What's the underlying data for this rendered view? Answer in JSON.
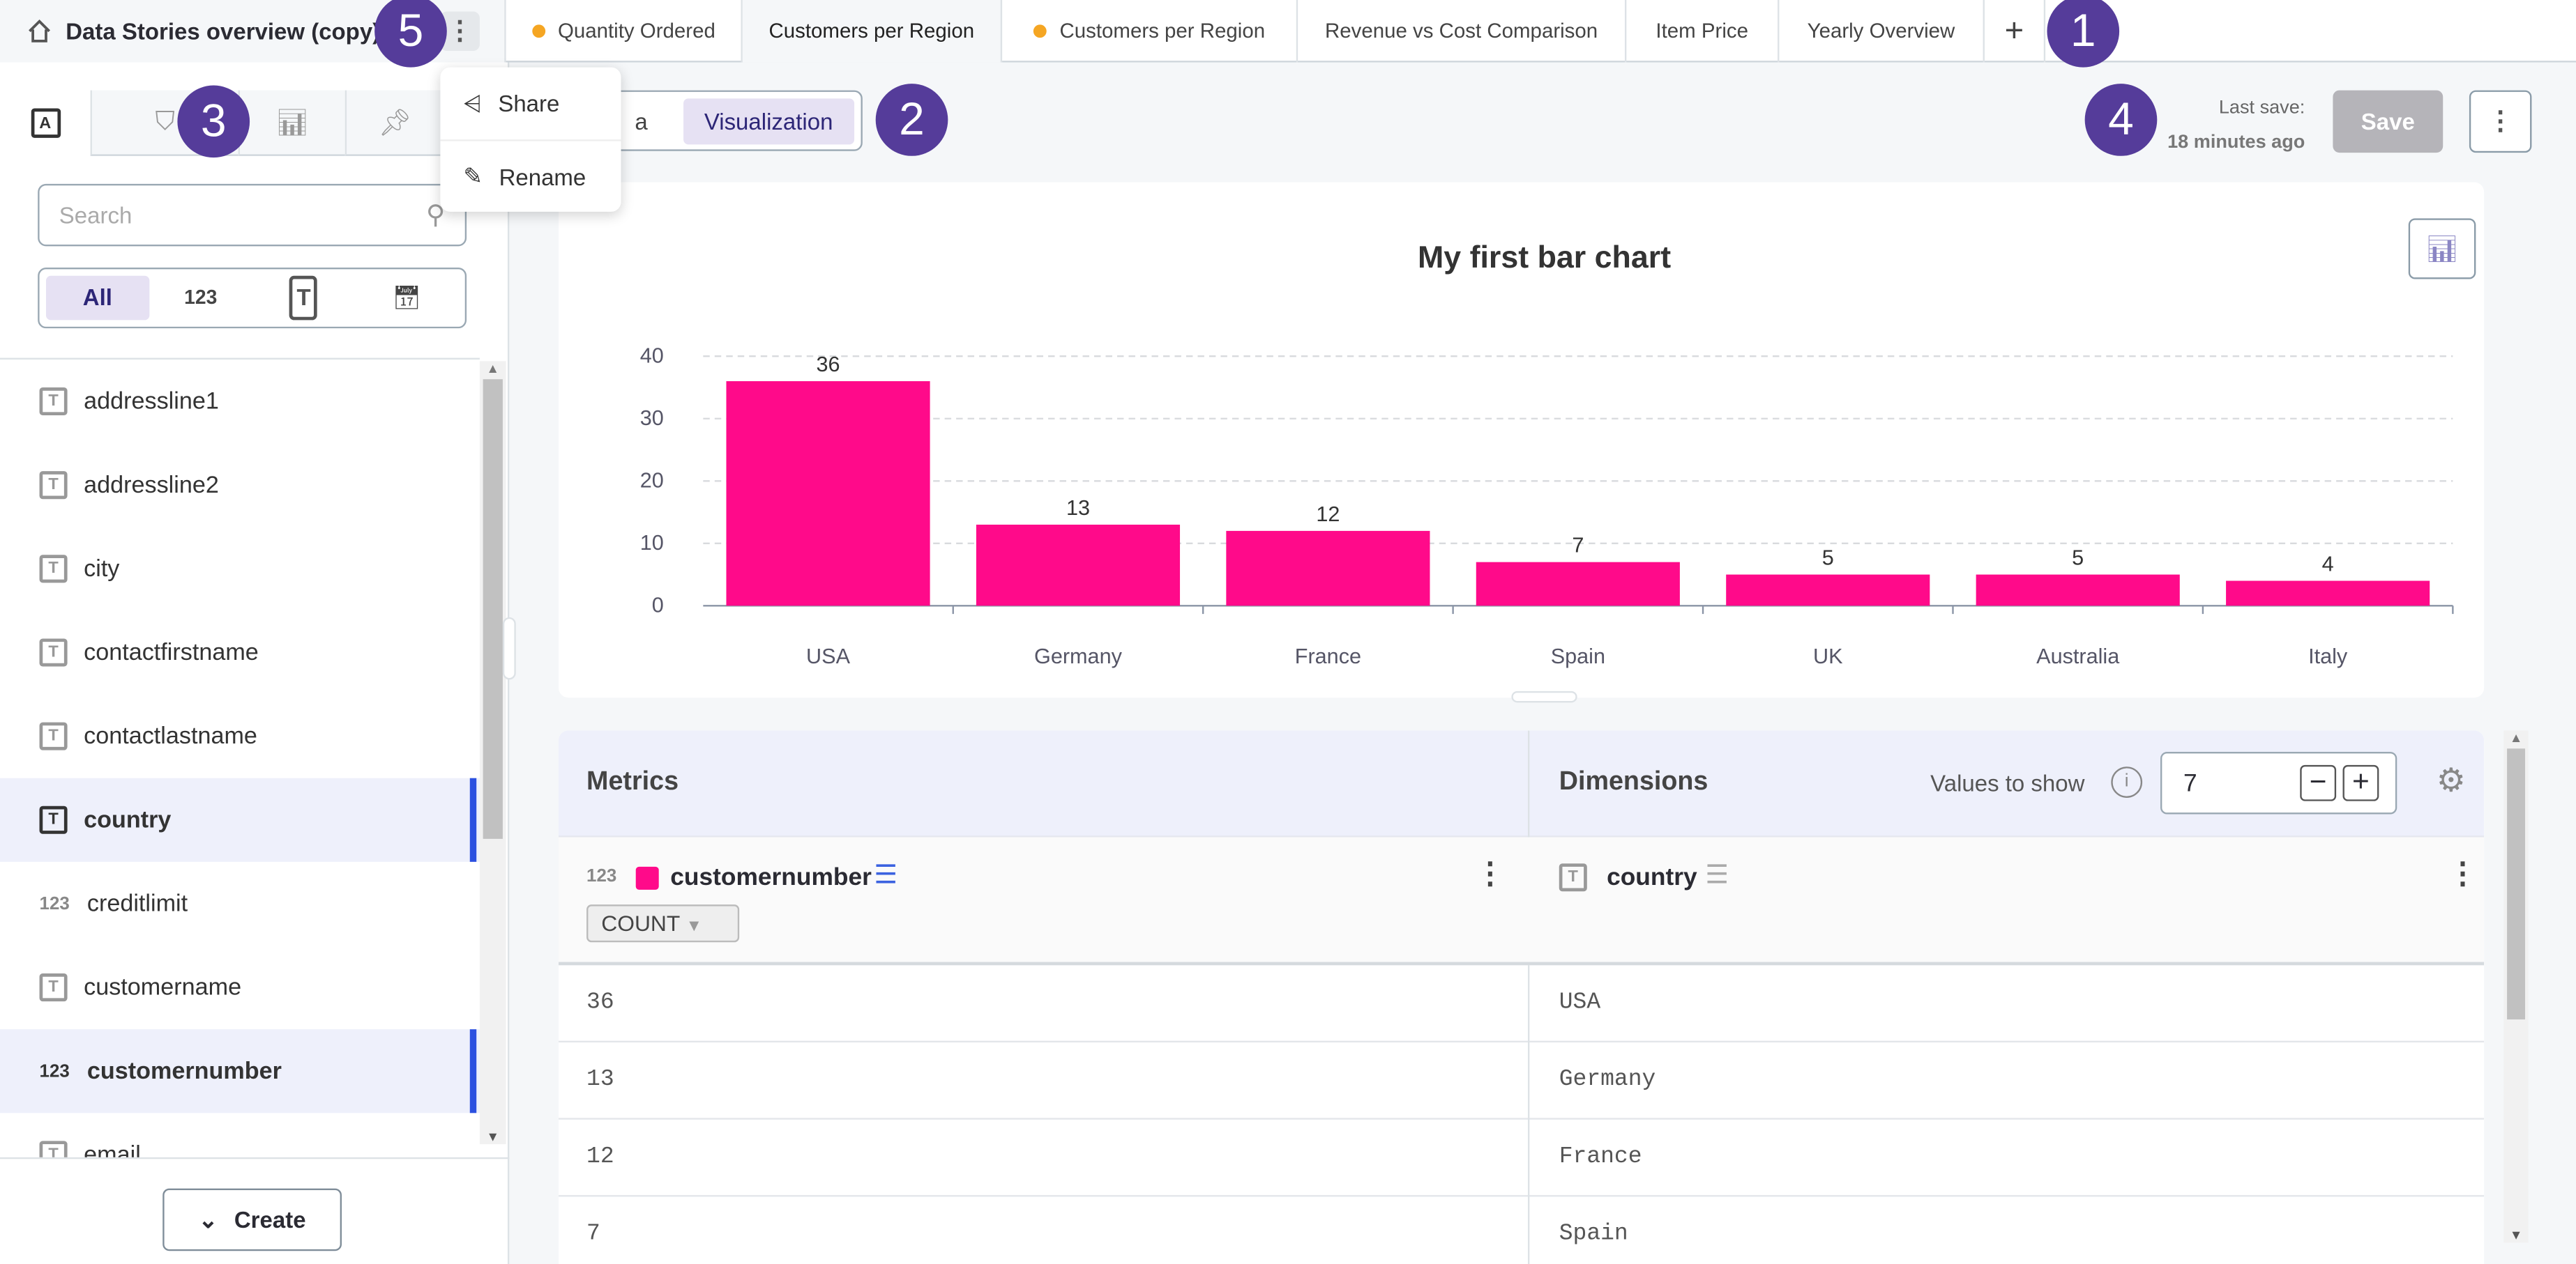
{
  "header": {
    "title": "Data Stories overview (copy)",
    "tabs": [
      {
        "label": "Quantity Ordered",
        "unsaved": true
      },
      {
        "label": "Customers per Region",
        "unsaved": false,
        "active": true
      },
      {
        "label": "Customers per Region",
        "unsaved": true
      },
      {
        "label": "Revenue vs Cost Comparison",
        "unsaved": false
      },
      {
        "label": "Item Price",
        "unsaved": false
      },
      {
        "label": "Yearly Overview",
        "unsaved": false
      }
    ],
    "add_tab": "+"
  },
  "badges": [
    "1",
    "2",
    "3",
    "4",
    "5"
  ],
  "context_menu": {
    "items": [
      {
        "label": "Share",
        "icon": "share-icon"
      },
      {
        "label": "Rename",
        "icon": "pencil-icon"
      }
    ]
  },
  "sidebar": {
    "search_placeholder": "Search",
    "filters": [
      "All",
      "123",
      "T",
      "calendar"
    ],
    "fields": [
      {
        "name": "addressline1",
        "type": "T"
      },
      {
        "name": "addressline2",
        "type": "T"
      },
      {
        "name": "city",
        "type": "T"
      },
      {
        "name": "contactfirstname",
        "type": "T"
      },
      {
        "name": "contactlastname",
        "type": "T"
      },
      {
        "name": "country",
        "type": "T",
        "selected": true
      },
      {
        "name": "creditlimit",
        "type": "123"
      },
      {
        "name": "customername",
        "type": "T"
      },
      {
        "name": "customernumber",
        "type": "123",
        "selected": true
      },
      {
        "name": "email",
        "type": "T"
      }
    ],
    "create_label": "Create"
  },
  "toolbar": {
    "mode": [
      "Data",
      "Visualization"
    ],
    "mode_visible": "a",
    "active_mode": "Visualization",
    "last_save_label": "Last save:",
    "last_save_time": "18 minutes ago",
    "save_label": "Save"
  },
  "chart_data": {
    "type": "bar",
    "title": "My first bar chart",
    "categories": [
      "USA",
      "Germany",
      "France",
      "Spain",
      "UK",
      "Australia",
      "Italy"
    ],
    "values": [
      36,
      13,
      12,
      7,
      5,
      5,
      4
    ],
    "ylim": [
      0,
      40
    ],
    "yticks": [
      "0",
      "10",
      "20",
      "30",
      "40"
    ],
    "grid": true,
    "color": "#ff0a8a"
  },
  "table": {
    "metrics_label": "Metrics",
    "dimensions_label": "Dimensions",
    "values_to_show_label": "Values to show",
    "values_to_show": "7",
    "metric": {
      "type": "123",
      "name": "customernumber",
      "agg": "COUNT",
      "color": "#ff0a8a"
    },
    "dimension": {
      "type": "T",
      "name": "country"
    },
    "rows": [
      [
        "36",
        "USA"
      ],
      [
        "13",
        "Germany"
      ],
      [
        "12",
        "France"
      ],
      [
        "7",
        "Spain"
      ]
    ]
  }
}
